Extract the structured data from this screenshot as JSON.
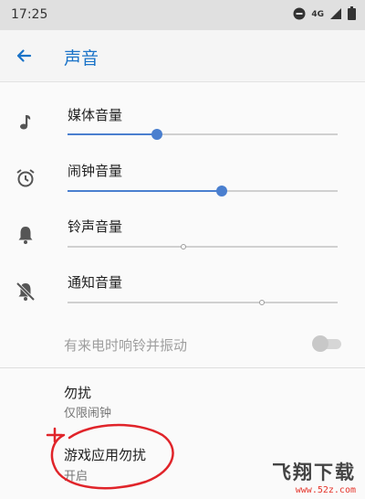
{
  "status_bar": {
    "time": "17:25",
    "network": "4G",
    "icons": [
      "do-not-disturb-icon",
      "signal-icon",
      "battery-icon"
    ]
  },
  "app_bar": {
    "title": "声音",
    "back_icon": "arrow-back-icon",
    "accent_color": "#1a73c8"
  },
  "volume_sliders": [
    {
      "label": "媒体音量",
      "icon": "music-note-icon",
      "level": 0.33
    },
    {
      "label": "闹钟音量",
      "icon": "alarm-clock-icon",
      "level": 0.57
    },
    {
      "label": "铃声音量",
      "icon": "bell-icon",
      "level": 0.43
    },
    {
      "label": "通知音量",
      "icon": "bell-off-icon",
      "level": 0.72
    }
  ],
  "vibrate": {
    "label": "有来电时响铃并振动",
    "enabled": false
  },
  "settings": [
    {
      "title": "勿扰",
      "subtitle": "仅限闹钟"
    },
    {
      "title": "游戏应用勿扰",
      "subtitle": "开启"
    }
  ],
  "watermark": {
    "main": "飞翔下载",
    "sub": "www.52z.com"
  },
  "colors": {
    "slider_active": "#4a7fcf",
    "annotation": "#e0242a"
  }
}
